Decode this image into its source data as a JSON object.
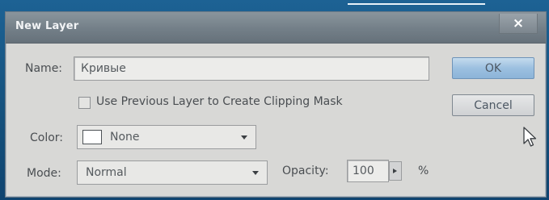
{
  "dialog": {
    "title": "New Layer",
    "close_label": "×"
  },
  "name_field": {
    "label": "Name:",
    "value": "Кривые"
  },
  "clipping_mask": {
    "label": "Use Previous Layer to Create Clipping Mask",
    "checked": false
  },
  "color": {
    "label": "Color:",
    "value": "None",
    "swatch_color": "#ffffff"
  },
  "mode": {
    "label": "Mode:",
    "value": "Normal"
  },
  "opacity": {
    "label": "Opacity:",
    "value": "100",
    "unit": "%"
  },
  "buttons": {
    "ok_label": "OK",
    "cancel_label": "Cancel"
  },
  "colors": {
    "accent": "#9cc0e0",
    "dialog_bg": "#d8d8d6",
    "titlebar": "#737f88"
  },
  "icons": {
    "close": "close-icon",
    "dropdown": "chevron-down-icon",
    "stepper": "chevron-right-icon",
    "cursor": "mouse-pointer-icon"
  }
}
